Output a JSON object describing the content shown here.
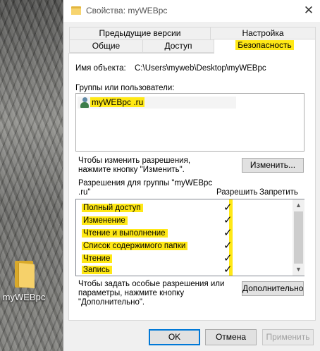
{
  "desktop": {
    "icon_label": "myWEBpc"
  },
  "window": {
    "title": "Свойства: myWEBpc",
    "close_glyph": "✕"
  },
  "tabs": {
    "row1": [
      "Предыдущие версии",
      "Настройка"
    ],
    "row2": [
      "Общие",
      "Доступ",
      "Безопасность"
    ],
    "active": "Безопасность"
  },
  "security": {
    "object_name_label": "Имя объекта:",
    "object_name_value": "C:\\Users\\myweb\\Desktop\\myWEBpc",
    "groups_label": "Группы или пользователи:",
    "groups": [
      {
        "name": "myWEBpc .ru",
        "icon": "user-group-icon"
      }
    ],
    "change_hint_line1": "Чтобы изменить разрешения,",
    "change_hint_line2": "нажмите кнопку \"Изменить\".",
    "change_button": "Изменить...",
    "perms_for_line1": "Разрешения для группы \"myWEBpc",
    "perms_for_line2": ".ru\"",
    "allow_header": "Разрешить",
    "deny_header": "Запретить",
    "permissions": [
      {
        "name": "Полный доступ",
        "allow": true,
        "deny": false
      },
      {
        "name": "Изменение",
        "allow": true,
        "deny": false
      },
      {
        "name": "Чтение и выполнение",
        "allow": true,
        "deny": false
      },
      {
        "name": "Список содержимого папки",
        "allow": true,
        "deny": false
      },
      {
        "name": "Чтение",
        "allow": true,
        "deny": false
      },
      {
        "name": "Запись",
        "allow": true,
        "deny": false
      }
    ],
    "check_glyph": "✓",
    "advanced_hint_line1": "Чтобы задать особые разрешения или",
    "advanced_hint_line2": "параметры, нажмите кнопку",
    "advanced_hint_line3": "\"Дополнительно\".",
    "advanced_button": "Дополнительно"
  },
  "footer": {
    "ok": "OK",
    "cancel": "Отмена",
    "apply": "Применить"
  },
  "colors": {
    "highlight": "#ffe815",
    "focus": "#0078d7"
  }
}
